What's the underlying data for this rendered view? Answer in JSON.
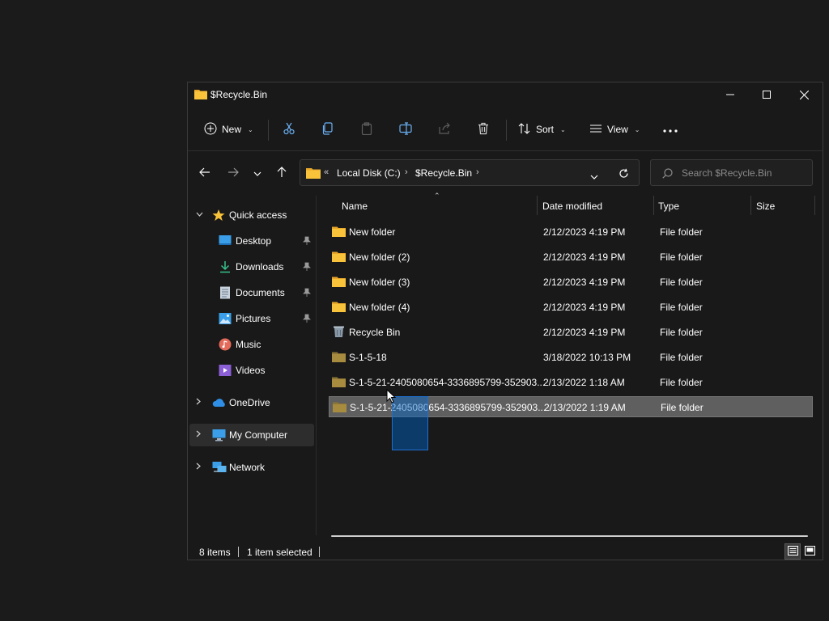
{
  "window": {
    "title": "$Recycle.Bin"
  },
  "toolbar": {
    "new_label": "New",
    "sort_label": "Sort",
    "view_label": "View"
  },
  "address": {
    "overflow": "«",
    "crumbs": [
      "Local Disk (C:)",
      "$Recycle.Bin"
    ]
  },
  "search": {
    "placeholder": "Search $Recycle.Bin"
  },
  "sidebar": {
    "items": [
      {
        "label": "Quick access",
        "icon": "star-icon"
      },
      {
        "label": "Desktop",
        "icon": "desktop-icon",
        "pinned": true
      },
      {
        "label": "Downloads",
        "icon": "download-icon",
        "pinned": true
      },
      {
        "label": "Documents",
        "icon": "document-icon",
        "pinned": true
      },
      {
        "label": "Pictures",
        "icon": "picture-icon",
        "pinned": true
      },
      {
        "label": "Music",
        "icon": "music-icon"
      },
      {
        "label": "Videos",
        "icon": "video-icon"
      },
      {
        "label": "OneDrive",
        "icon": "cloud-icon"
      },
      {
        "label": "My Computer",
        "icon": "computer-icon",
        "selected": true
      },
      {
        "label": "Network",
        "icon": "network-icon"
      }
    ]
  },
  "columns": {
    "name": "Name",
    "date": "Date modified",
    "type": "Type",
    "size": "Size"
  },
  "files": [
    {
      "name": "New folder",
      "date": "2/12/2023 4:19 PM",
      "type": "File folder",
      "icon": "folder-icon"
    },
    {
      "name": "New folder (2)",
      "date": "2/12/2023 4:19 PM",
      "type": "File folder",
      "icon": "folder-icon"
    },
    {
      "name": "New folder (3)",
      "date": "2/12/2023 4:19 PM",
      "type": "File folder",
      "icon": "folder-icon"
    },
    {
      "name": "New folder (4)",
      "date": "2/12/2023 4:19 PM",
      "type": "File folder",
      "icon": "folder-icon"
    },
    {
      "name": "Recycle Bin",
      "date": "2/12/2023 4:19 PM",
      "type": "File folder",
      "icon": "recycle-bin-icon"
    },
    {
      "name": "S-1-5-18",
      "date": "3/18/2022 10:13 PM",
      "type": "File folder",
      "icon": "system-folder-icon"
    },
    {
      "name": "S-1-5-21-2405080654-3336895799-352903...",
      "date": "2/13/2022 1:18 AM",
      "type": "File folder",
      "icon": "system-folder-icon"
    },
    {
      "name": "S-1-5-21-2405080654-3336895799-352903...",
      "date": "2/13/2022 1:19 AM",
      "type": "File folder",
      "icon": "system-folder-icon",
      "selected": true
    }
  ],
  "status": {
    "count": "8 items",
    "selected": "1 item selected"
  },
  "colors": {
    "folder": "#f8c23a",
    "accent": "#1e6fd0",
    "selection": "#5f5f5f"
  }
}
